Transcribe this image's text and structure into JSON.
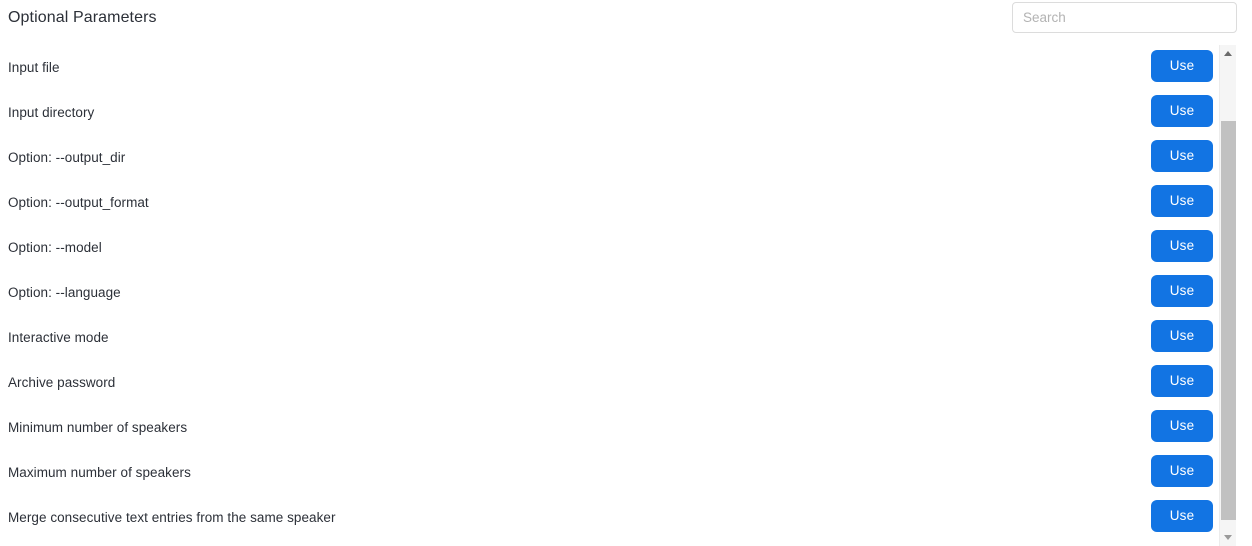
{
  "header": {
    "title": "Optional Parameters",
    "search": {
      "placeholder": "Search",
      "value": ""
    }
  },
  "list": {
    "use_label": "Use",
    "rows": [
      {
        "label": "Input file",
        "action": "Use"
      },
      {
        "label": "Input directory",
        "action": "Use"
      },
      {
        "label": "Option: --output_dir",
        "action": "Use"
      },
      {
        "label": "Option: --output_format",
        "action": "Use"
      },
      {
        "label": "Option: --model",
        "action": "Use"
      },
      {
        "label": "Option: --language",
        "action": "Use"
      },
      {
        "label": "Interactive mode",
        "action": "Use"
      },
      {
        "label": "Archive password",
        "action": "Use"
      },
      {
        "label": "Minimum number of speakers",
        "action": "Use"
      },
      {
        "label": "Maximum number of speakers",
        "action": "Use"
      },
      {
        "label": "Merge consecutive text entries from the same speaker",
        "action": "Use"
      }
    ]
  },
  "scrollbar": {
    "up_icon": "caret-up-icon",
    "down_icon": "caret-down-icon"
  },
  "colors": {
    "accent": "#1274e3",
    "text": "#2c3038",
    "placeholder": "#b3b3b3",
    "border": "#dcdcdc",
    "scroll_thumb": "#c1c1c1",
    "scroll_track": "#f5f5f5",
    "background": "#ffffff"
  }
}
